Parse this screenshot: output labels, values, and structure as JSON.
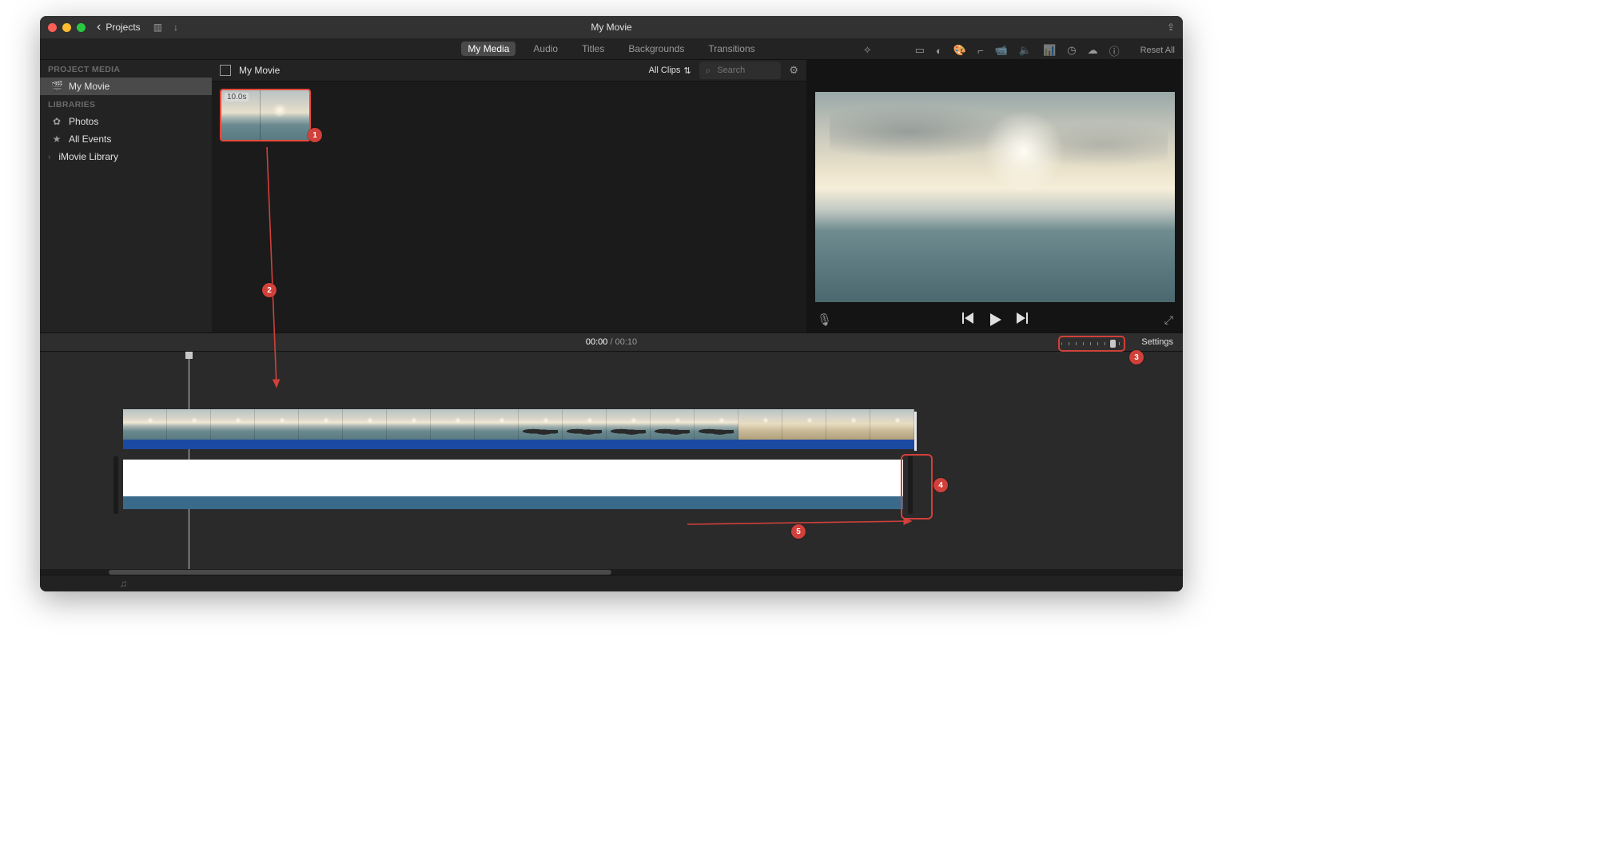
{
  "titlebar": {
    "back_label": "Projects",
    "window_title": "My Movie"
  },
  "media_tabs": {
    "items": [
      "My Media",
      "Audio",
      "Titles",
      "Backgrounds",
      "Transitions"
    ],
    "active_index": 0
  },
  "sidebar": {
    "section_project": "PROJECT MEDIA",
    "project_item": "My Movie",
    "section_libraries": "LIBRARIES",
    "photos": "Photos",
    "all_events": "All Events",
    "imovie_library": "iMovie Library"
  },
  "browser": {
    "title": "My Movie",
    "filter_label": "All Clips",
    "search_placeholder": "Search",
    "clip": {
      "duration_label": "10.0s"
    }
  },
  "preview": {
    "reset_label": "Reset All"
  },
  "timeline": {
    "current_time": "00:00",
    "total_time": "00:10",
    "settings_label": "Settings"
  },
  "annotations": {
    "badge1": "1",
    "badge2": "2",
    "badge3": "3",
    "badge4": "4",
    "badge5": "5"
  },
  "icons": {
    "layout": "▥",
    "import": "↓",
    "share": "⇪",
    "wand": "✧",
    "screen": "▭",
    "balance": "◐",
    "palette": "🎨",
    "crop": "⌐",
    "stabilize": "📹",
    "volume": "🔈",
    "eq": "📊",
    "speed": "◷",
    "filter": "☁",
    "info": "ⓘ",
    "search": "⌕",
    "gear": "⚙",
    "updown": "⇅",
    "mic": "🎙",
    "fullscreen": "⤢",
    "chevright": "›",
    "music": "♫",
    "clapper": "🎬",
    "flower": "✿",
    "star": "★"
  }
}
